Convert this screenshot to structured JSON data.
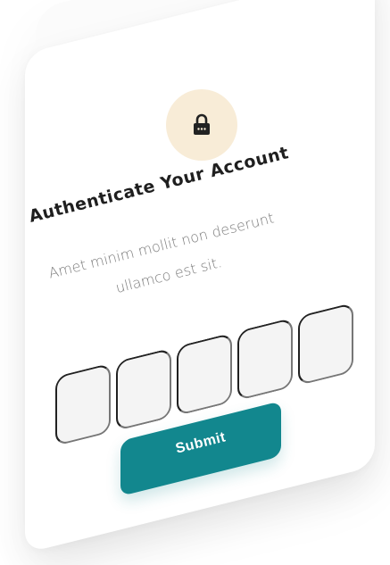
{
  "dialog": {
    "title": "Authenticate Your Account",
    "subtitle_line1": "Amet minim mollit non deserunt",
    "subtitle_line2": "ullamco est sit.",
    "icon": "lock-icon",
    "code_cells": [
      "",
      "",
      "",
      "",
      ""
    ],
    "submit_label": "Submit"
  },
  "colors": {
    "accent": "#12878e",
    "badge_bg": "#f8ecd7",
    "cell_bg": "#f4f4f4",
    "title": "#1f1f1f",
    "subtitle": "#7c7c7c"
  }
}
